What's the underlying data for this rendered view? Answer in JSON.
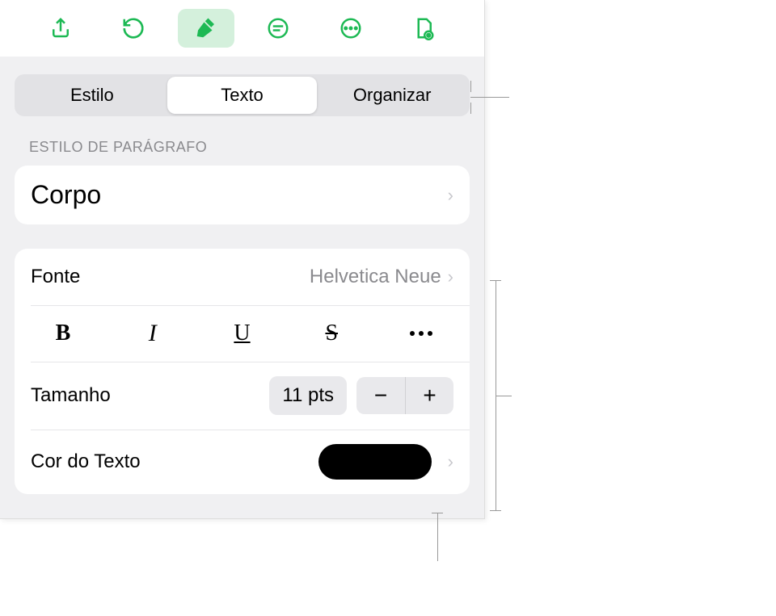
{
  "accent_color": "#1db954",
  "toolbar": {
    "share": "share",
    "undo": "undo",
    "format": "format-brush",
    "comment": "comment",
    "more": "more",
    "insert": "insert"
  },
  "tabs": {
    "style": "Estilo",
    "text": "Texto",
    "arrange": "Organizar"
  },
  "sections": {
    "paragraph_style_header": "Estilo de Parágrafo",
    "paragraph_style_value": "Corpo",
    "font_label": "Fonte",
    "font_value": "Helvetica Neue",
    "bold": "B",
    "italic": "I",
    "underline": "U",
    "strike": "S",
    "size_label": "Tamanho",
    "size_value": "11 pts",
    "text_color_label": "Cor do Texto",
    "text_color_value": "#000000"
  }
}
